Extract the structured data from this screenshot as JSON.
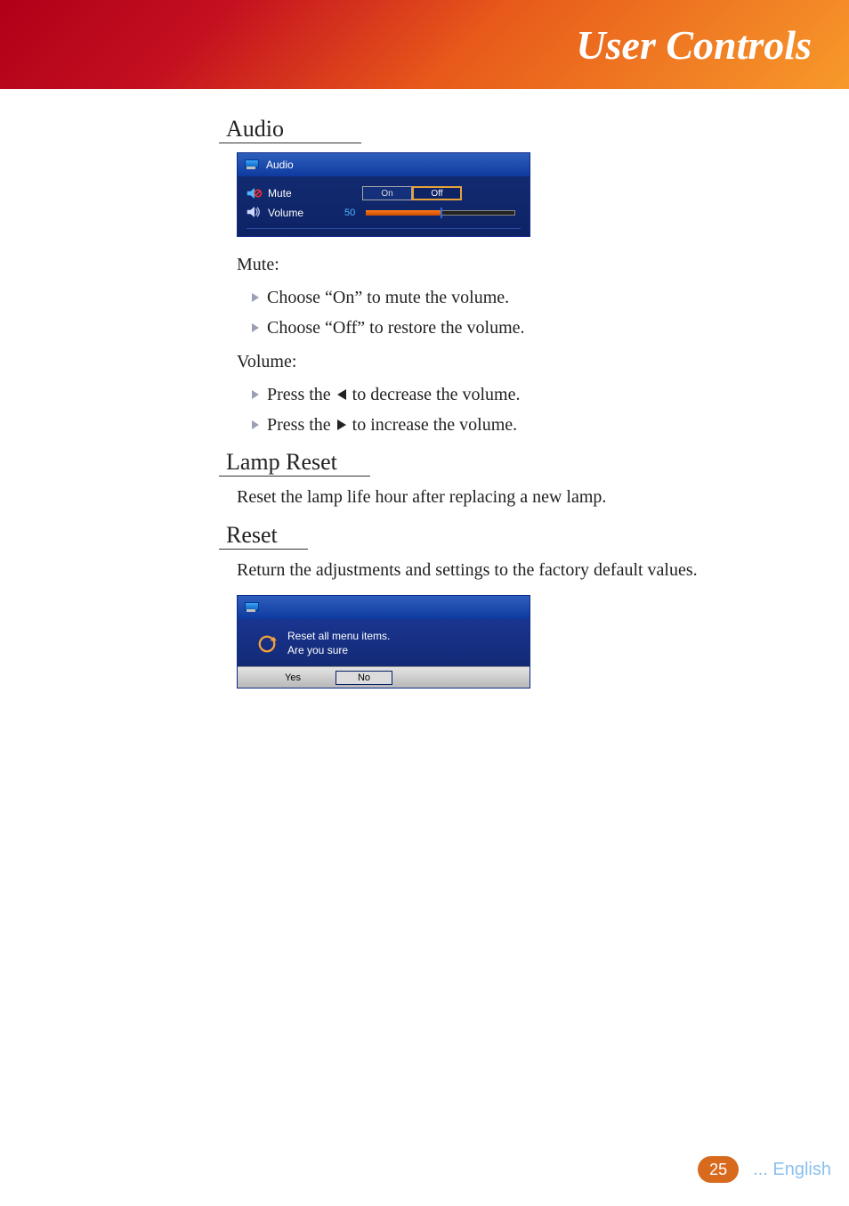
{
  "header": {
    "title": "User Controls"
  },
  "sections": {
    "audio": {
      "heading": "Audio",
      "osd": {
        "title": "Audio",
        "mute": {
          "label": "Mute",
          "on": "On",
          "off": "Off",
          "selected": "Off"
        },
        "volume": {
          "label": "Volume",
          "value": "50"
        }
      },
      "mute": {
        "heading": "Mute:",
        "bullets": [
          "Choose “On” to mute the volume.",
          "Choose “Off” to restore the volume."
        ]
      },
      "volume": {
        "heading": "Volume:",
        "bullets_prefix": "Press the ",
        "bullets_suffix_dec": " to decrease the volume.",
        "bullets_suffix_inc": " to increase the volume."
      }
    },
    "lamp_reset": {
      "heading": "Lamp Reset",
      "text": "Reset the lamp life hour after replacing a new lamp."
    },
    "reset": {
      "heading": "Reset",
      "text": "Return the adjustments and settings to the factory default values.",
      "osd": {
        "msg_line1": "Reset all menu items.",
        "msg_line2": "Are you sure",
        "yes": "Yes",
        "no": "No"
      }
    }
  },
  "footer": {
    "page": "25",
    "lang": "... English"
  }
}
